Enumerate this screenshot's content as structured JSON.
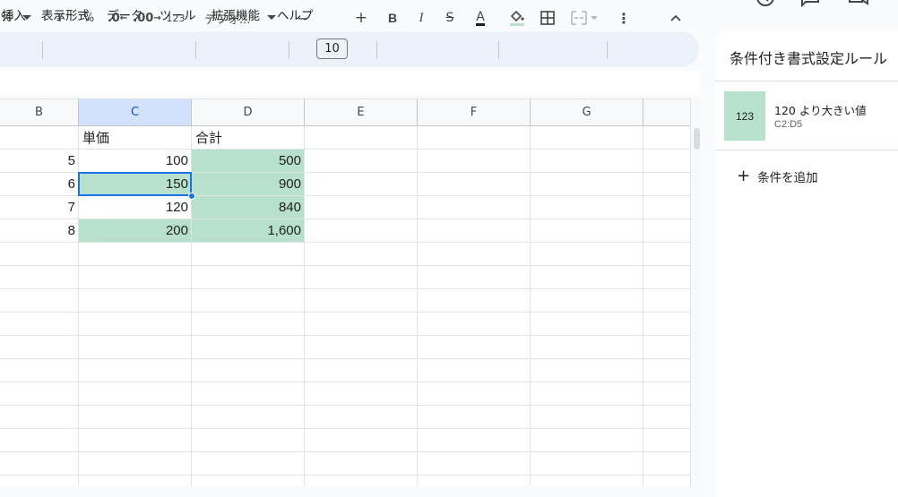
{
  "menu": {
    "items": [
      "挿入",
      "表示形式",
      "データ",
      "ツール",
      "拡張機能",
      "ヘルプ"
    ]
  },
  "toolbar": {
    "percent": "%",
    "yen": "¥",
    "percent2": "%",
    "dec_decrease": ".0",
    "dec_increase": ".00",
    "number_format": "123",
    "font_name": "デフォ...",
    "font_size": "10",
    "minus": "−",
    "plus": "+",
    "bold": "B",
    "italic": "I",
    "strike": "S",
    "text_color": "A",
    "more": "⋮",
    "collapse": "^"
  },
  "columns": [
    "B",
    "C",
    "D",
    "E",
    "F",
    "G"
  ],
  "selected_column": "C",
  "rows": [
    {
      "b": "",
      "c": "単価",
      "d": "合計"
    },
    {
      "b": "5",
      "c": "100",
      "d": "500"
    },
    {
      "b": "6",
      "c": "150",
      "d": "900"
    },
    {
      "b": "7",
      "c": "120",
      "d": "840"
    },
    {
      "b": "8",
      "c": "200",
      "d": "1,600"
    }
  ],
  "highlight_color": "#b7e1cd",
  "selection_color": "#1a73e8",
  "panel": {
    "title": "条件付き書式設定ルール",
    "rule": {
      "swatch_text": "123",
      "description": "120 より大きい値",
      "range": "C2:D5"
    },
    "add_rule_label": "条件を追加"
  }
}
